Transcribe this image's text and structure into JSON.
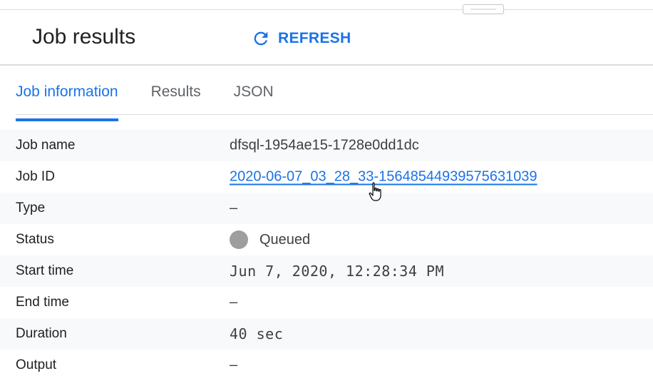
{
  "header": {
    "title": "Job results",
    "refresh_label": "REFRESH",
    "accent_color": "#1a73e8"
  },
  "tabs": [
    {
      "label": "Job information",
      "active": true
    },
    {
      "label": "Results",
      "active": false
    },
    {
      "label": "JSON",
      "active": false
    }
  ],
  "details": {
    "job_name": {
      "label": "Job name",
      "value": "dfsql-1954ae15-1728e0dd1dc"
    },
    "job_id": {
      "label": "Job ID",
      "value": "2020-06-07_03_28_33-15648544939575631039"
    },
    "type": {
      "label": "Type",
      "value": "–"
    },
    "status": {
      "label": "Status",
      "value": "Queued",
      "dot_color": "#9e9e9e"
    },
    "start_time": {
      "label": "Start time",
      "value": "Jun 7, 2020, 12:28:34 PM"
    },
    "end_time": {
      "label": "End time",
      "value": "–"
    },
    "duration": {
      "label": "Duration",
      "value": "40 sec"
    },
    "output": {
      "label": "Output",
      "value": "–"
    }
  },
  "icons": {
    "refresh": "refresh-icon",
    "cursor": "hand-pointer-icon",
    "status": "status-dot"
  }
}
